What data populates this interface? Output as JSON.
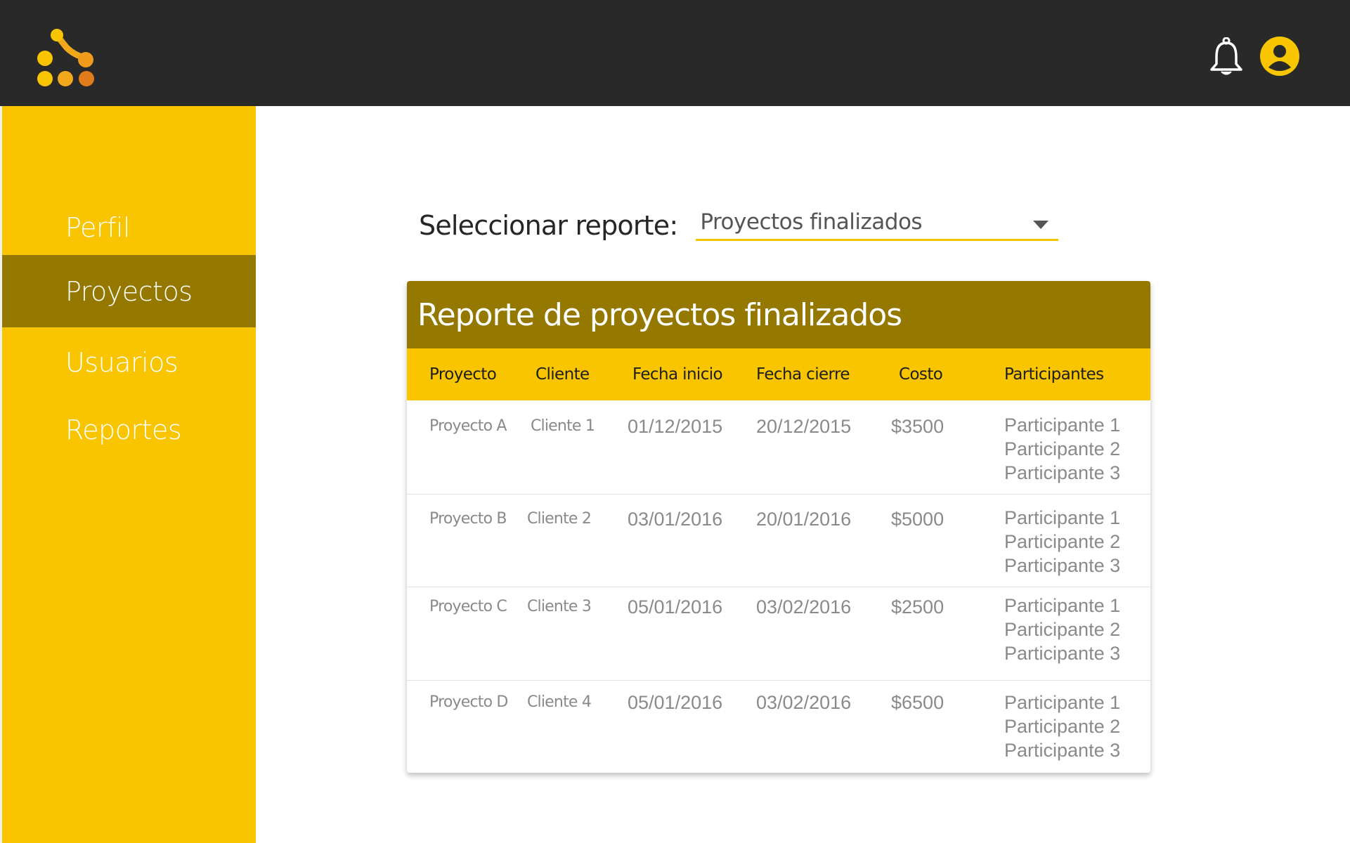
{
  "header": {
    "logo_icon": "network-dots-logo-icon",
    "notifications_icon": "bell-icon",
    "account_icon": "user-circle-icon"
  },
  "sidebar": {
    "items": [
      {
        "label": "Perfil",
        "active": false
      },
      {
        "label": "Proyectos",
        "active": true
      },
      {
        "label": "Usuarios",
        "active": false
      },
      {
        "label": "Reportes",
        "active": false
      }
    ]
  },
  "report_selector": {
    "label": "Seleccionar reporte:",
    "value": "Proyectos finalizados"
  },
  "report": {
    "title": "Reporte de proyectos finalizados",
    "columns": [
      "Proyecto",
      "Cliente",
      "Fecha inicio",
      "Fecha cierre",
      "Costo",
      "Participantes"
    ],
    "rows": [
      {
        "proyecto": "Proyecto A",
        "cliente": "Cliente 1",
        "fecha_inicio": "01/12/2015",
        "fecha_cierre": "20/12/2015",
        "costo": "$3500",
        "participantes": [
          "Participante 1",
          "Participante 2",
          "Participante 3"
        ]
      },
      {
        "proyecto": "Proyecto B",
        "cliente": "Cliente 2",
        "fecha_inicio": "03/01/2016",
        "fecha_cierre": "20/01/2016",
        "costo": "$5000",
        "participantes": [
          "Participante 1",
          "Participante 2",
          "Participante 3"
        ]
      },
      {
        "proyecto": "Proyecto C",
        "cliente": "Cliente 3",
        "fecha_inicio": "05/01/2016",
        "fecha_cierre": "03/02/2016",
        "costo": "$2500",
        "participantes": [
          "Participante 1",
          "Participante 2",
          "Participante 3"
        ]
      },
      {
        "proyecto": "Proyecto D",
        "cliente": "Cliente 4",
        "fecha_inicio": "05/01/2016",
        "fecha_cierre": "03/02/2016",
        "costo": "$6500",
        "participantes": [
          "Participante 1",
          "Participante 2",
          "Participante 3"
        ]
      }
    ]
  },
  "colors": {
    "topbar": "#292929",
    "accent_yellow": "#f8c500",
    "accent_dark": "#947800",
    "logo_orange": "#e9891d"
  }
}
